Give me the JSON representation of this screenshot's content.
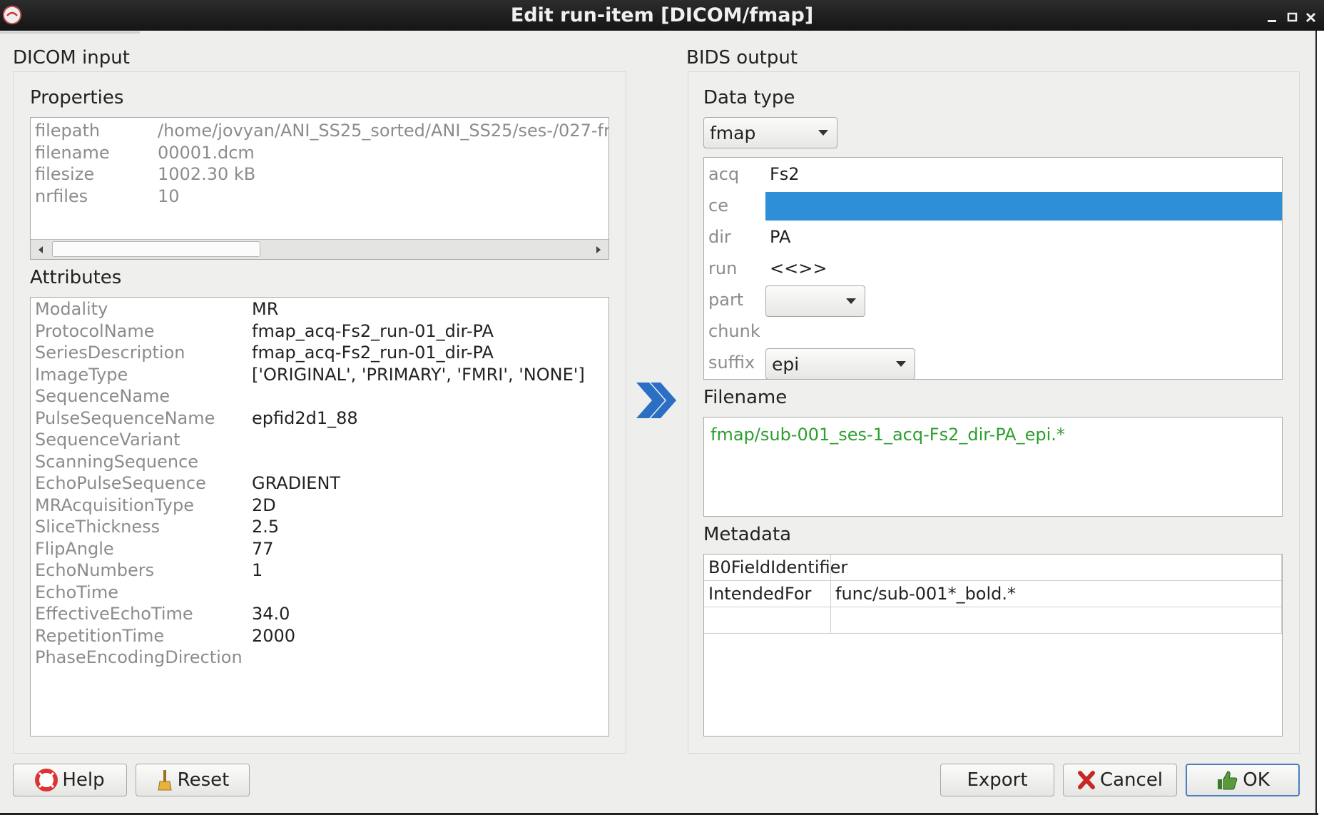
{
  "window": {
    "title": "Edit run-item [DICOM/fmap]"
  },
  "dicom": {
    "label": "DICOM input",
    "properties": {
      "label": "Properties",
      "rows": [
        {
          "key": "filepath",
          "value": "/home/jovyan/ANI_SS25_sorted/ANI_SS25/ses-/027-fr"
        },
        {
          "key": "filename",
          "value": "00001.dcm"
        },
        {
          "key": "filesize",
          "value": "1002.30 kB"
        },
        {
          "key": "nrfiles",
          "value": "10"
        }
      ]
    },
    "attributes": {
      "label": "Attributes",
      "rows": [
        {
          "key": "Modality",
          "value": "MR"
        },
        {
          "key": "ProtocolName",
          "value": "fmap_acq-Fs2_run-01_dir-PA"
        },
        {
          "key": "SeriesDescription",
          "value": "fmap_acq-Fs2_run-01_dir-PA"
        },
        {
          "key": "ImageType",
          "value": "['ORIGINAL', 'PRIMARY', 'FMRI', 'NONE']"
        },
        {
          "key": "SequenceName",
          "value": ""
        },
        {
          "key": "PulseSequenceName",
          "value": "epfid2d1_88"
        },
        {
          "key": "SequenceVariant",
          "value": ""
        },
        {
          "key": "ScanningSequence",
          "value": ""
        },
        {
          "key": "EchoPulseSequence",
          "value": "GRADIENT"
        },
        {
          "key": "MRAcquisitionType",
          "value": "2D"
        },
        {
          "key": "SliceThickness",
          "value": "2.5"
        },
        {
          "key": "FlipAngle",
          "value": "77"
        },
        {
          "key": "EchoNumbers",
          "value": "1"
        },
        {
          "key": "EchoTime",
          "value": ""
        },
        {
          "key": "EffectiveEchoTime",
          "value": "34.0"
        },
        {
          "key": "RepetitionTime",
          "value": "2000"
        },
        {
          "key": "PhaseEncodingDirection",
          "value": ""
        }
      ]
    }
  },
  "bids": {
    "label": "BIDS output",
    "datatype": {
      "label": "Data type",
      "value": "fmap"
    },
    "entities": [
      {
        "key": "acq",
        "value": "Fs2"
      },
      {
        "key": "ce",
        "value": ""
      },
      {
        "key": "dir",
        "value": "PA"
      },
      {
        "key": "run",
        "value": "<<>>"
      },
      {
        "key": "part",
        "value": ""
      },
      {
        "key": "chunk",
        "value": ""
      },
      {
        "key": "suffix",
        "value": "epi"
      }
    ],
    "filename": {
      "label": "Filename",
      "value": "fmap/sub-001_ses-1_acq-Fs2_dir-PA_epi.*"
    },
    "metadata": {
      "label": "Metadata",
      "rows": [
        {
          "key": "B0FieldIdentifier",
          "value": ""
        },
        {
          "key": "IntendedFor",
          "value": "func/sub-001*_bold.*"
        },
        {
          "key": "",
          "value": ""
        }
      ]
    }
  },
  "buttons": {
    "help": "Help",
    "reset": "Reset",
    "export": "Export",
    "cancel": "Cancel",
    "ok": "OK"
  },
  "colors": {
    "selection": "#2d8fd5",
    "filename_text": "#2e9e2e",
    "arrow": "#2a6fc4"
  }
}
